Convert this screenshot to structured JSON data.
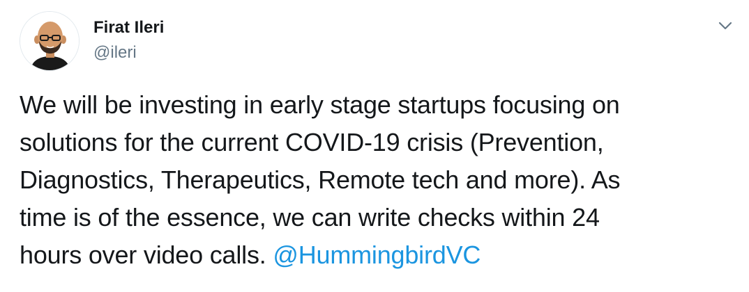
{
  "author": {
    "name": "Firat Ileri",
    "handle": "@ileri"
  },
  "tweet": {
    "lines": [
      "We will be investing in early stage startups focusing on",
      "solutions for the current COVID-19 crisis (Prevention,",
      "Diagnostics, Therapeutics, Remote tech and more). As",
      "time is of the essence, we can write checks within 24",
      "hours over video calls. "
    ],
    "mention": "@HummingbirdVC"
  },
  "icons": {
    "more": "chevron-down-icon",
    "avatar": "avatar"
  },
  "colors": {
    "text": "#14171a",
    "secondary": "#657786",
    "link": "#1b95e0"
  }
}
